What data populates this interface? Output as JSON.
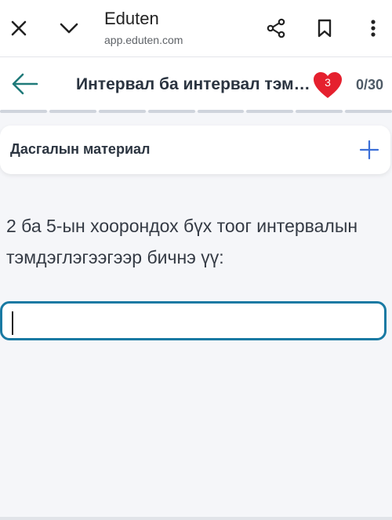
{
  "browser": {
    "site_title": "Eduten",
    "site_url": "app.eduten.com",
    "icons": [
      "close-icon",
      "chevron-down-icon",
      "share-icon",
      "bookmark-icon",
      "more-vert-icon"
    ]
  },
  "header": {
    "title": "Интервал ба интервал тэмдэглэгээ",
    "lives": "3",
    "progress": "0/30",
    "progress_segments": 8,
    "accent_color": "#1f7a79",
    "heart_color": "#e5202e"
  },
  "material": {
    "label": "Дасгалын материал",
    "plus_color": "#3b6fd8"
  },
  "question": {
    "text": "2 ба 5-ын хоорондох бүх тоог интервалын тэмдэглэгээгээр бичнэ үү:"
  },
  "answer": {
    "value": "",
    "border_color": "#197aa3"
  }
}
